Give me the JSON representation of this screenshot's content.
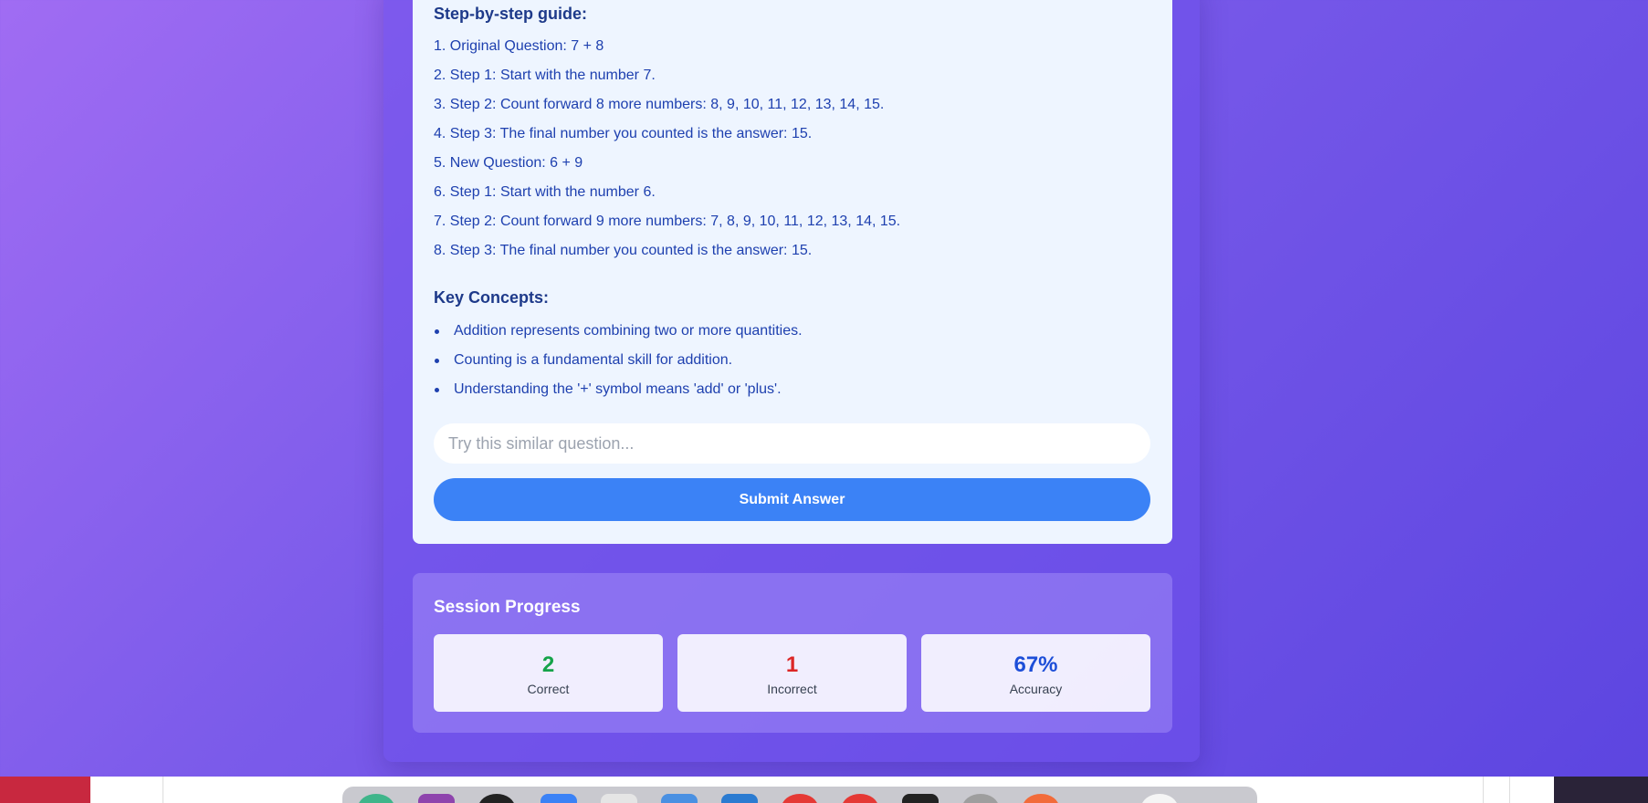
{
  "guide": {
    "title": "Step-by-step guide:",
    "steps": [
      "1. Original Question: 7 + 8",
      "2. Step 1: Start with the number 7.",
      "3. Step 2: Count forward 8 more numbers: 8, 9, 10, 11, 12, 13, 14, 15.",
      "4. Step 3: The final number you counted is the answer: 15.",
      "5. New Question: 6 + 9",
      "6. Step 1: Start with the number 6.",
      "7. Step 2: Count forward 9 more numbers: 7, 8, 9, 10, 11, 12, 13, 14, 15.",
      "8. Step 3: The final number you counted is the answer: 15."
    ]
  },
  "concepts": {
    "title": "Key Concepts:",
    "items": [
      "Addition represents combining two or more quantities.",
      "Counting is a fundamental skill for addition.",
      "Understanding the '+' symbol means 'add' or 'plus'."
    ]
  },
  "answer": {
    "placeholder": "Try this similar question...",
    "value": "",
    "submit_label": "Submit Answer"
  },
  "progress": {
    "title": "Session Progress",
    "correct": {
      "value": "2",
      "label": "Correct",
      "color": "#16a34a"
    },
    "incorrect": {
      "value": "1",
      "label": "Incorrect",
      "color": "#dc2626"
    },
    "accuracy": {
      "value": "67%",
      "label": "Accuracy",
      "color": "#1d4ed8"
    }
  },
  "colors": {
    "accent": "#3b82f6",
    "heading": "#1e3a8a",
    "body_text": "#1e40af"
  }
}
